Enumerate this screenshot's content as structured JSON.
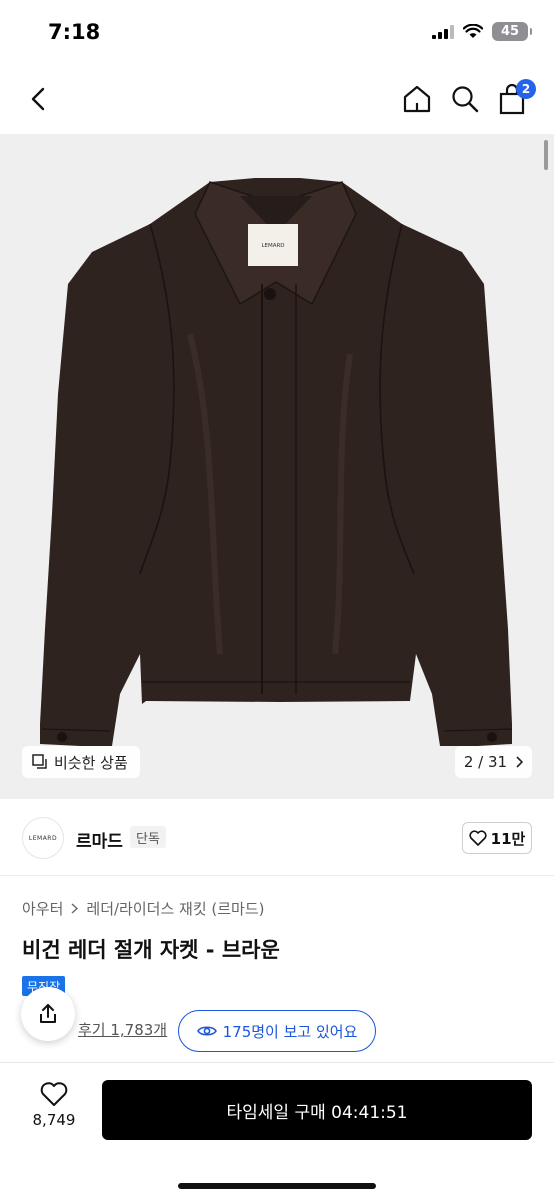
{
  "status_bar": {
    "time": "7:18",
    "battery": "45"
  },
  "header": {
    "cart_badge": "2"
  },
  "gallery": {
    "label_brand": "LEMARD",
    "similar_label": "비슷한 상품",
    "page_counter": "2 / 31"
  },
  "brand": {
    "logo_text": "LEMARD",
    "name": "르마드",
    "tag": "단독",
    "likes": "11만"
  },
  "product": {
    "breadcrumb": [
      "아우터",
      "레더/라이더스 재킷 (르마드)"
    ],
    "title": "비건 레더 절개 자켓 - 브라운",
    "badge": "무진장",
    "reviews": "후기 1,783개",
    "viewers": "175명이 보고 있어요"
  },
  "bottom_bar": {
    "wish_count": "8,749",
    "buy_label": "타임세일 구매 04:41:51"
  },
  "colors": {
    "accent": "#2563eb",
    "buy_button": "#000000",
    "jacket": "#2f2320"
  }
}
